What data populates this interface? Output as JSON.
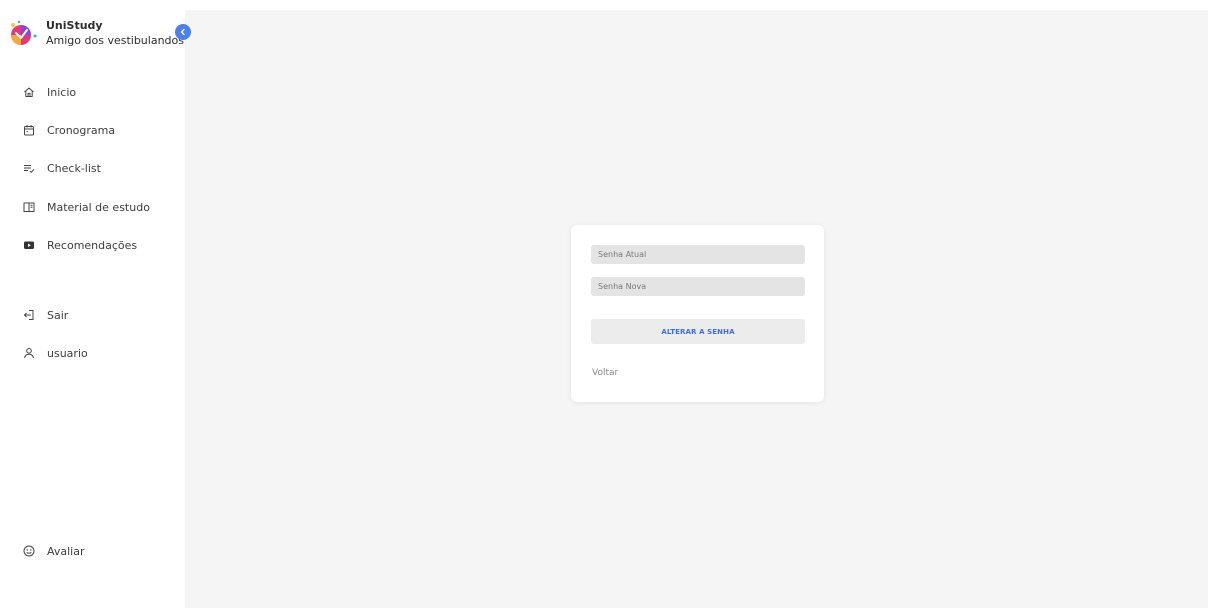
{
  "brand": {
    "name": "UniStudy",
    "tagline": "Amigo dos vestibulandos"
  },
  "nav": {
    "items": [
      {
        "label": "Inicio",
        "icon": "home-icon"
      },
      {
        "label": "Cronograma",
        "icon": "calendar-icon"
      },
      {
        "label": "Check-list",
        "icon": "checklist-icon"
      },
      {
        "label": "Material de estudo",
        "icon": "book-icon"
      },
      {
        "label": "Recomendações",
        "icon": "video-icon"
      },
      {
        "label": "Sair",
        "icon": "logout-icon"
      },
      {
        "label": "usuario",
        "icon": "user-icon"
      },
      {
        "label": "Avaliar",
        "icon": "smile-icon"
      }
    ]
  },
  "form": {
    "current_password_placeholder": "Senha Atual",
    "new_password_placeholder": "Senha Nova",
    "submit_label": "ALTERAR A SENHA",
    "back_label": "Voltar"
  },
  "colors": {
    "accent": "#3f6df2",
    "collapse_button": "#4a7ff0",
    "main_background": "#f5f5f5",
    "field_background": "#e4e4e4"
  }
}
